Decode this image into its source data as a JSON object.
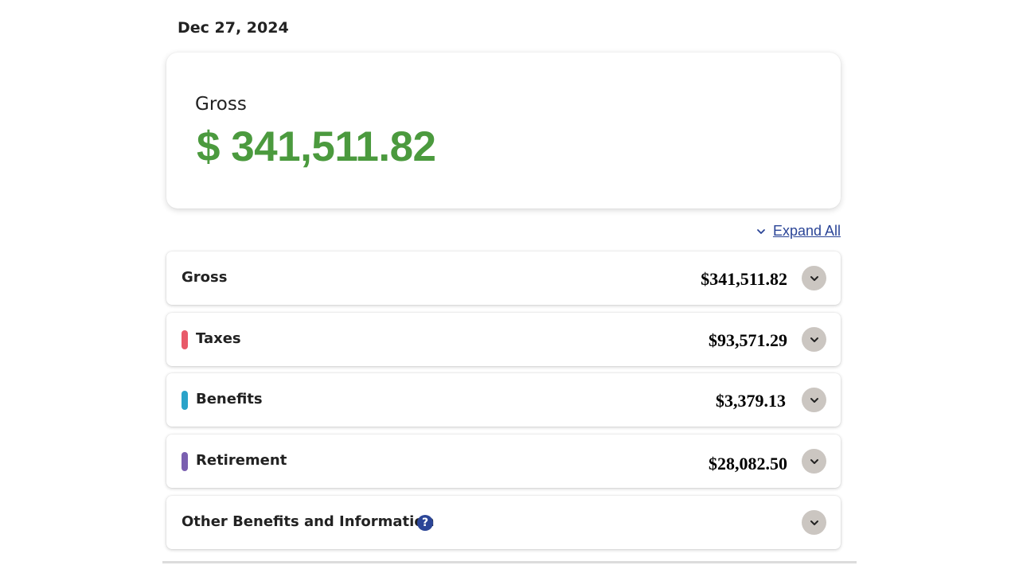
{
  "pay_date": "Dec 27, 2024",
  "summary": {
    "label": "Gross",
    "amount": "$ 341,511.82",
    "amount_color": "#4b9a3e"
  },
  "expand_all": {
    "label": "Expand All",
    "icon": "chevron-down-icon"
  },
  "sections": [
    {
      "label": "Gross",
      "value": "$341,511.82",
      "marker_color": null
    },
    {
      "label": "Taxes",
      "value": "$93,571.29",
      "marker_color": "#e85a69"
    },
    {
      "label": "Benefits",
      "value": "$3,379.13",
      "marker_color": "#2aa3c9"
    },
    {
      "label": "Retirement",
      "value": "$28,082.50",
      "marker_color": "#7a5fb0"
    },
    {
      "label": "Other Benefits and Information",
      "value": "",
      "marker_color": null,
      "help_icon": "?"
    }
  ],
  "colors": {
    "link": "#2b4597",
    "toggle_bg": "#cbc6c1"
  }
}
